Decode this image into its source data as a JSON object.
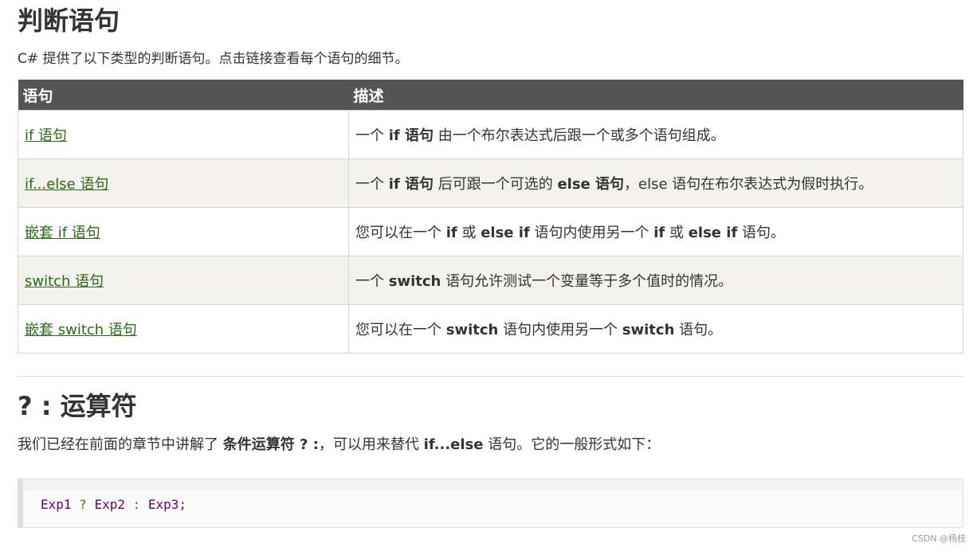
{
  "section1": {
    "title": "判断语句",
    "intro": "C# 提供了以下类型的判断语句。点击链接查看每个语句的细节。"
  },
  "table": {
    "headers": [
      "语句",
      "描述"
    ],
    "rows": [
      {
        "link": "if 语句",
        "desc": [
          {
            "t": "一个 "
          },
          {
            "t": "if 语句",
            "b": true
          },
          {
            "t": " 由一个布尔表达式后跟一个或多个语句组成。"
          }
        ]
      },
      {
        "link": "if...else 语句",
        "desc": [
          {
            "t": "一个 "
          },
          {
            "t": "if 语句",
            "b": true
          },
          {
            "t": " 后可跟一个可选的 "
          },
          {
            "t": "else 语句",
            "b": true
          },
          {
            "t": "，else 语句在布尔表达式为假时执行。"
          }
        ]
      },
      {
        "link": "嵌套 if 语句",
        "desc": [
          {
            "t": "您可以在一个 "
          },
          {
            "t": "if",
            "b": true
          },
          {
            "t": " 或 "
          },
          {
            "t": "else if",
            "b": true
          },
          {
            "t": " 语句内使用另一个 "
          },
          {
            "t": "if",
            "b": true
          },
          {
            "t": " 或 "
          },
          {
            "t": "else if",
            "b": true
          },
          {
            "t": " 语句。"
          }
        ]
      },
      {
        "link": "switch 语句",
        "desc": [
          {
            "t": "一个 "
          },
          {
            "t": "switch",
            "b": true
          },
          {
            "t": " 语句允许测试一个变量等于多个值时的情况。"
          }
        ]
      },
      {
        "link": "嵌套 switch 语句",
        "desc": [
          {
            "t": "您可以在一个 "
          },
          {
            "t": "switch",
            "b": true
          },
          {
            "t": " 语句内使用另一个 "
          },
          {
            "t": "switch",
            "b": true
          },
          {
            "t": " 语句。"
          }
        ]
      }
    ]
  },
  "section2": {
    "title": "? : 运算符",
    "para": [
      {
        "t": "我们已经在前面的章节中讲解了 "
      },
      {
        "t": "条件运算符 ? :",
        "b": true
      },
      {
        "t": "，可以用来替代 "
      },
      {
        "t": "if...else",
        "b": true
      },
      {
        "t": " 语句。它的一般形式如下："
      }
    ],
    "code": [
      {
        "t": "Exp1",
        "c": "id"
      },
      {
        "t": " "
      },
      {
        "t": "?",
        "c": "op"
      },
      {
        "t": " "
      },
      {
        "t": "Exp2",
        "c": "id"
      },
      {
        "t": " "
      },
      {
        "t": ":",
        "c": "op"
      },
      {
        "t": " "
      },
      {
        "t": "Exp3",
        "c": "id"
      },
      {
        "t": ";"
      }
    ]
  },
  "watermark": "CSDN @杨枝"
}
